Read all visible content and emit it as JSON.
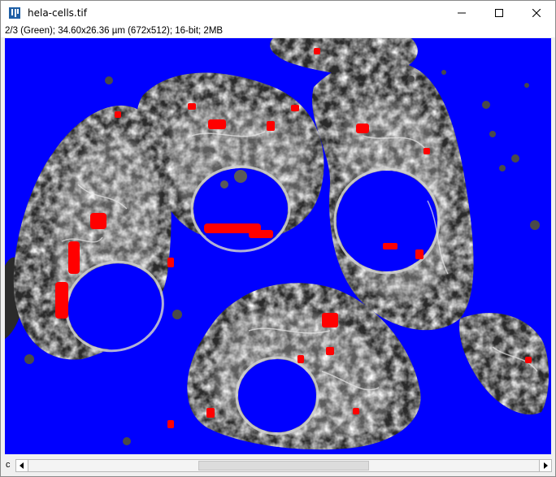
{
  "window": {
    "title": "hela-cells.tif",
    "app_icon": "imagej-icon",
    "controls": {
      "minimize_icon": "minimize-icon",
      "maximize_icon": "maximize-icon",
      "close_icon": "close-icon"
    }
  },
  "image_info": "2/3 (Green); 34.60x26.36 µm (672x512); 16-bit; 2MB",
  "image": {
    "description_icon": "fluorescence-image",
    "colors": {
      "background": "#0000ff",
      "cells": "#c8c8c8",
      "saturated": "#ff0000"
    }
  },
  "channel_slider": {
    "label": "c",
    "left_icon": "arrow-left-icon",
    "right_icon": "arrow-right-icon",
    "position": 0.5
  }
}
